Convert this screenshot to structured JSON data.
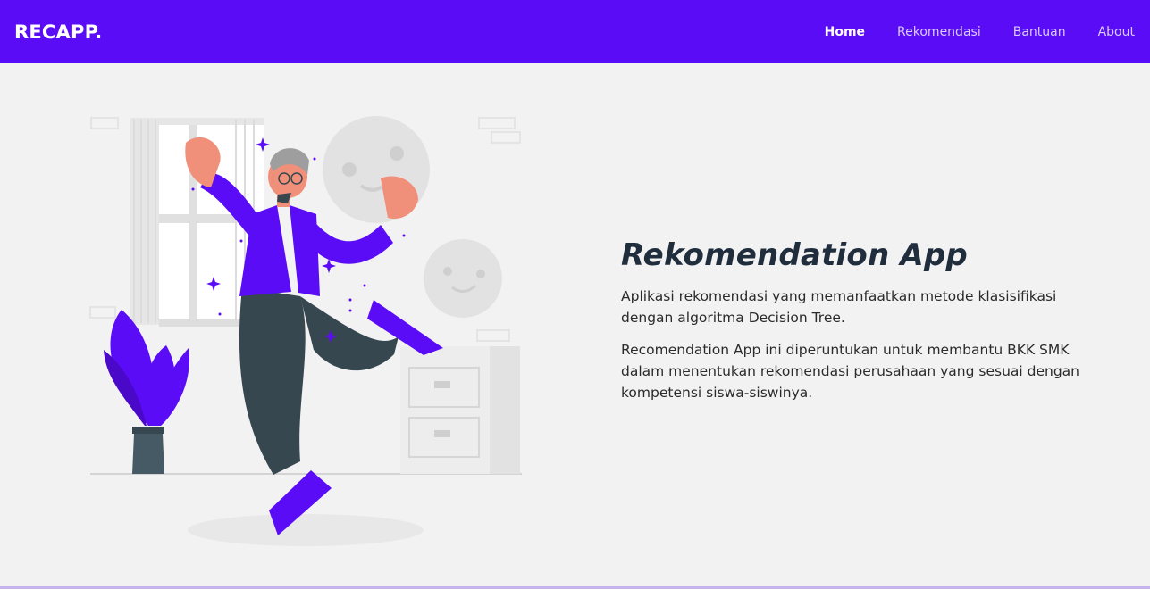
{
  "navbar": {
    "brand": "RECAPP.",
    "links": [
      {
        "label": "Home",
        "active": true
      },
      {
        "label": "Rekomendasi",
        "active": false
      },
      {
        "label": "Bantuan",
        "active": false
      },
      {
        "label": "About",
        "active": false
      }
    ]
  },
  "hero": {
    "title": "Rekomendation App",
    "paragraphs": [
      "Aplikasi rekomendasi yang memanfaatkan metode klasisifikasi dengan algoritma Decision Tree.",
      "Recomendation App ini diperuntukan untuk membantu BKK SMK dalam menentukan rekomendasi perusahaan yang sesuai dengan kompetensi siswa-siswinya."
    ]
  },
  "colors": {
    "primary": "#5b0cf7",
    "background": "#f2f2f2",
    "title": "#1f2d3d"
  }
}
